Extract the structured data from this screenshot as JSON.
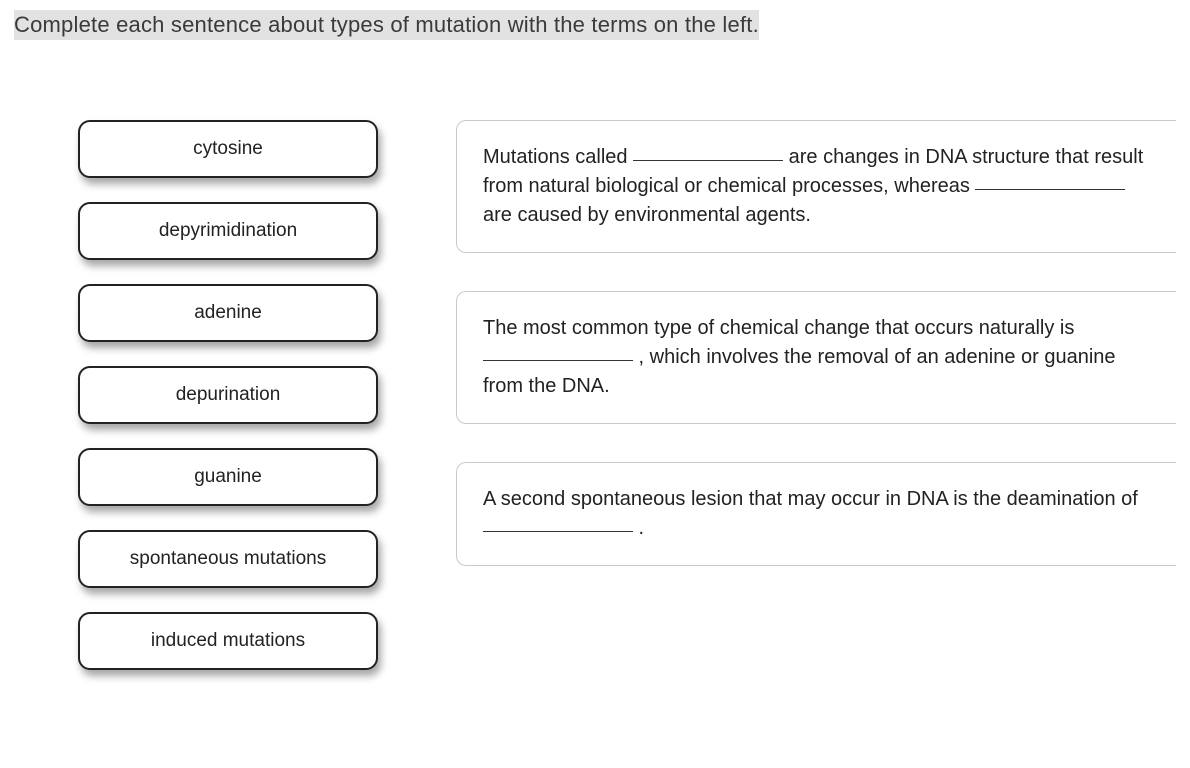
{
  "instruction": "Complete each sentence about types of mutation with the terms on the left.",
  "terms": {
    "t0": "cytosine",
    "t1": "depyrimidination",
    "t2": "adenine",
    "t3": "depurination",
    "t4": "guanine",
    "t5": "spontaneous mutations",
    "t6": "induced mutations"
  },
  "panels": {
    "p0": {
      "s0": "Mutations called ",
      "s1": " are changes in DNA structure that result from natural biological or chemical processes, whereas ",
      "s2": " are caused by environmental agents."
    },
    "p1": {
      "s0": "The most common type of chemical change that occurs naturally is ",
      "s1": " , which involves the removal of an adenine or guanine from the DNA."
    },
    "p2": {
      "s0": "A second spontaneous lesion that may occur in DNA is the deamination of ",
      "s1": " ."
    }
  }
}
